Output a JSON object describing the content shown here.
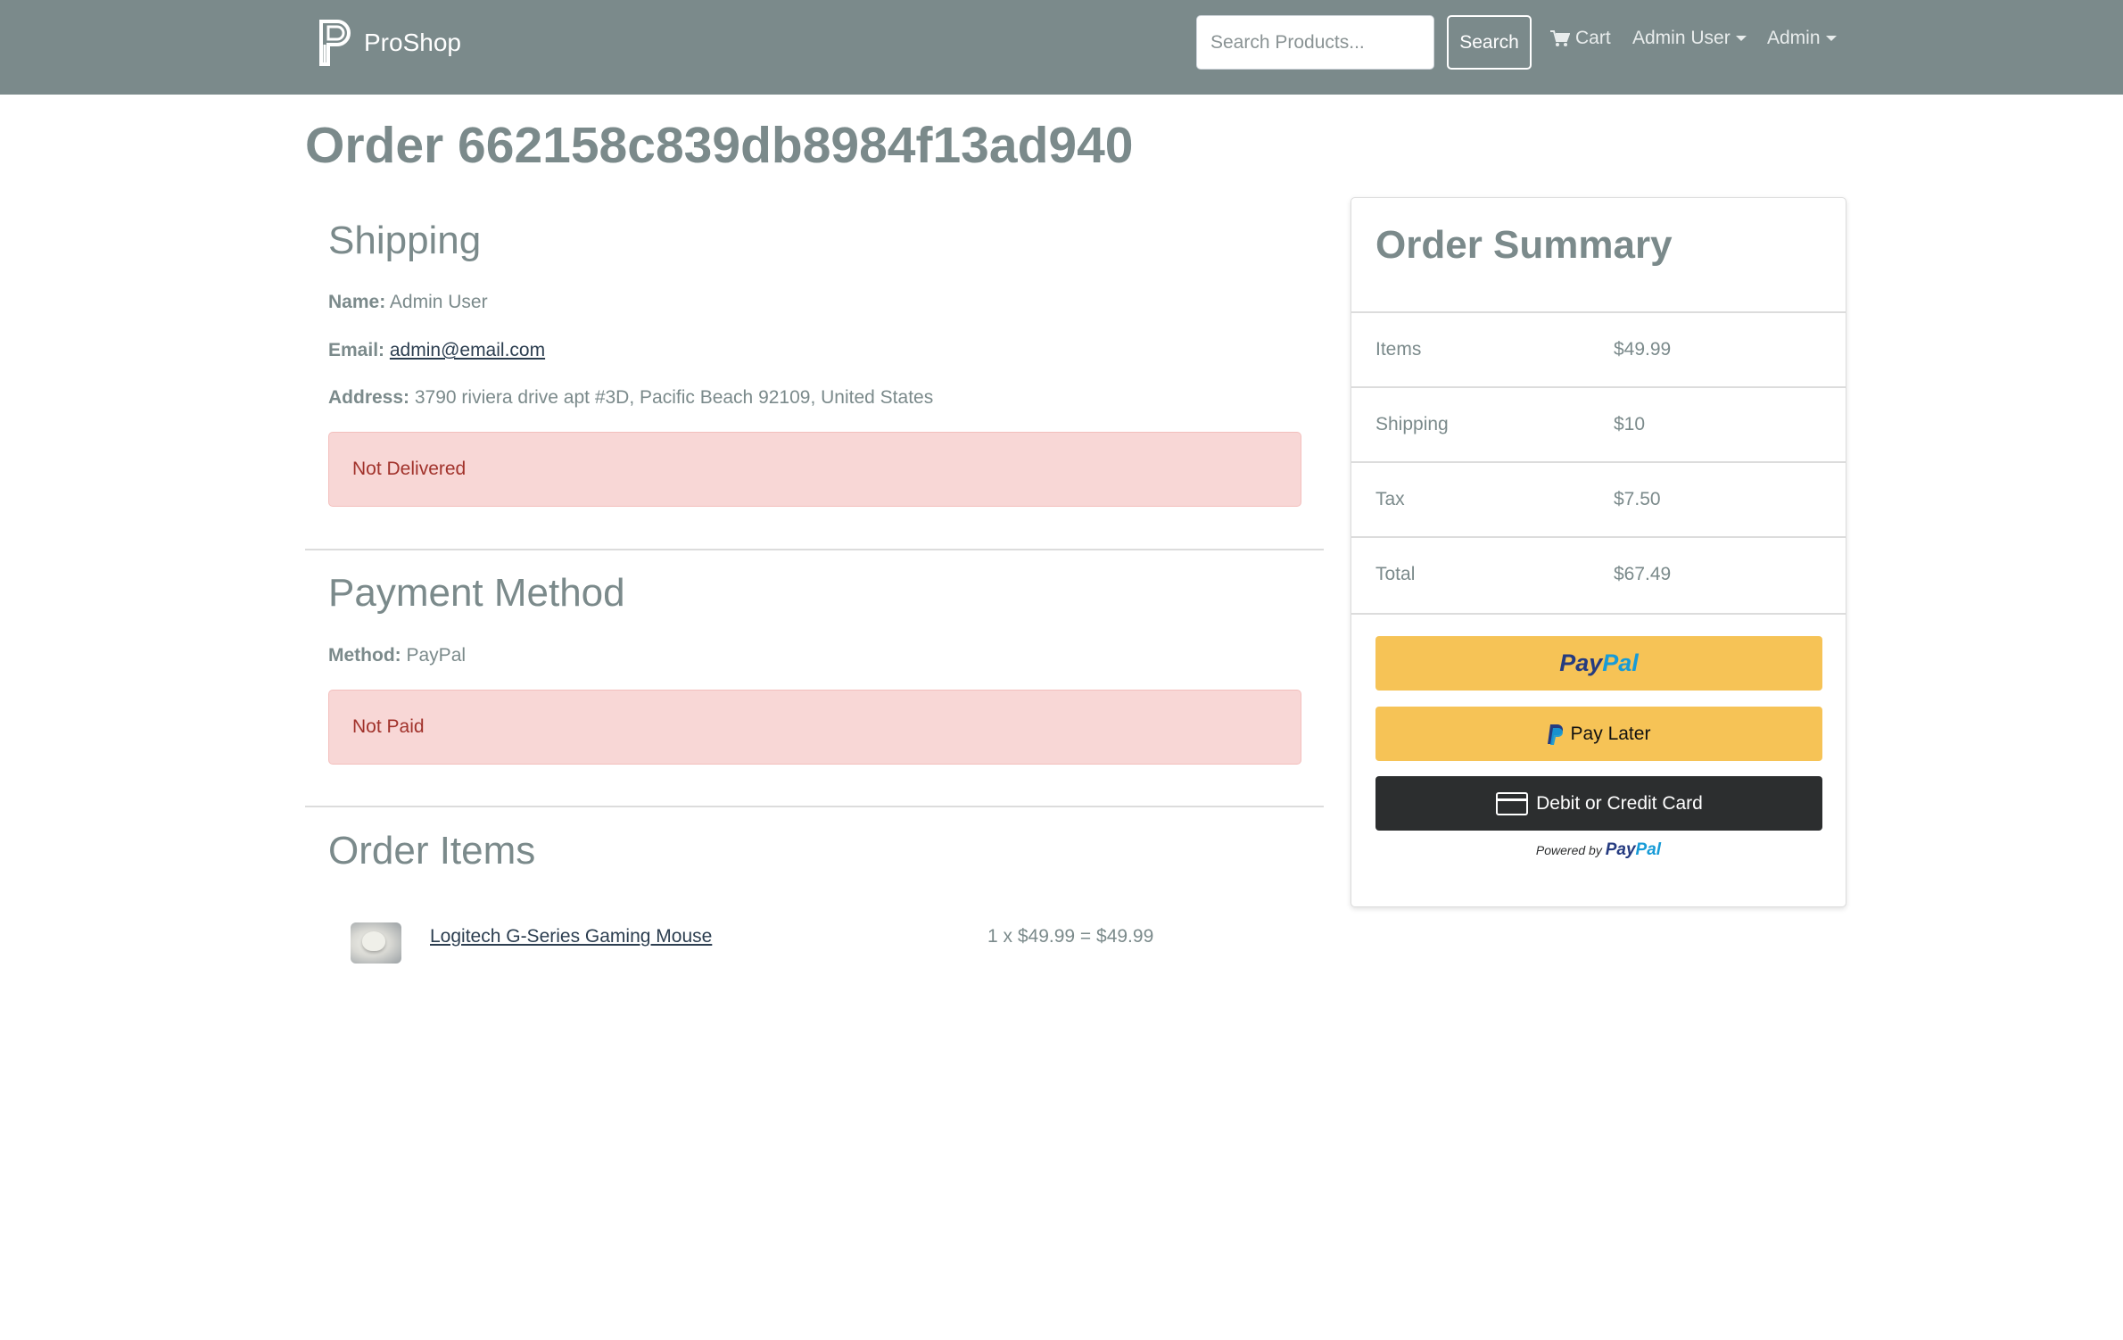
{
  "header": {
    "brand": "ProShop",
    "search_placeholder": "Search Products...",
    "search_button": "Search",
    "cart_label": "Cart",
    "user_menu": "Admin User",
    "admin_menu": "Admin"
  },
  "page_title": "Order 662158c839db8984f13ad940",
  "shipping": {
    "heading": "Shipping",
    "name_label": "Name:",
    "name": "Admin User",
    "email_label": "Email:",
    "email": "admin@email.com",
    "address_label": "Address:",
    "address": "3790 riviera drive apt #3D, Pacific Beach 92109, United States",
    "status": "Not Delivered"
  },
  "payment": {
    "heading": "Payment Method",
    "method_label": "Method:",
    "method": "PayPal",
    "status": "Not Paid"
  },
  "order_items": {
    "heading": "Order Items",
    "items": [
      {
        "name": "Logitech G-Series Gaming Mouse",
        "price_line": "1 x $49.99 = $49.99"
      }
    ]
  },
  "summary": {
    "heading": "Order Summary",
    "rows": [
      {
        "label": "Items",
        "value": "$49.99"
      },
      {
        "label": "Shipping",
        "value": "$10"
      },
      {
        "label": "Tax",
        "value": "$7.50"
      },
      {
        "label": "Total",
        "value": "$67.49"
      }
    ],
    "paypal_button": {
      "pay": "Pay",
      "pal": "Pal"
    },
    "pay_later_button": "Pay Later",
    "card_button": "Debit or Credit Card",
    "powered_by": "Powered by",
    "powered_brand": {
      "pay": "Pay",
      "pal": "Pal"
    }
  },
  "colors": {
    "navbar": "#7b8a8b",
    "alert_bg": "#f8d7d6",
    "alert_text": "#a1322b",
    "paypal_gold": "#f6c356",
    "card_button_bg": "#2c2e2f"
  },
  "icons": [
    "proshop-logo-icon",
    "cart-icon",
    "paypal-p-icon",
    "credit-card-icon"
  ]
}
